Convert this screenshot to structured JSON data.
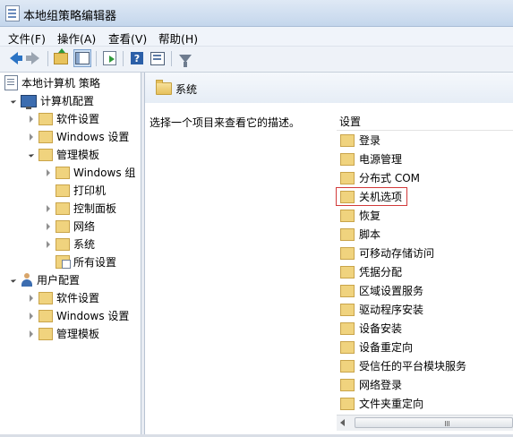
{
  "window": {
    "title": "本地组策略编辑器"
  },
  "menu": [
    "文件(F)",
    "操作(A)",
    "查看(V)",
    "帮助(H)"
  ],
  "toolbar": [
    {
      "name": "back-icon",
      "enabled": true
    },
    {
      "name": "forward-icon",
      "enabled": false
    },
    {
      "name": "up-folder-icon",
      "enabled": true
    },
    {
      "name": "show-hide-tree-icon",
      "enabled": true,
      "pressed": true
    },
    {
      "name": "export-list-icon",
      "enabled": true
    },
    {
      "name": "help-icon",
      "enabled": true
    },
    {
      "name": "properties-icon",
      "enabled": true
    },
    {
      "name": "filter-icon",
      "enabled": true
    }
  ],
  "tree": {
    "root": "本地计算机 策略",
    "computer_config": "计算机配置",
    "cc_software": "软件设置",
    "cc_windows": "Windows 设置",
    "cc_admin": "管理模板",
    "cc_admin_windows_components": "Windows 组",
    "cc_admin_printers": "打印机",
    "cc_admin_control_panel": "控制面板",
    "cc_admin_network": "网络",
    "cc_admin_system": "系统",
    "cc_admin_all_settings": "所有设置",
    "user_config": "用户配置",
    "uc_software": "软件设置",
    "uc_windows": "Windows 设置",
    "uc_admin": "管理模板"
  },
  "right": {
    "header_title": "系统",
    "description": "选择一个项目来查看它的描述。",
    "settings_column": "设置",
    "items": [
      "登录",
      "电源管理",
      "分布式 COM",
      "关机选项",
      "恢复",
      "脚本",
      "可移动存储访问",
      "凭据分配",
      "区域设置服务",
      "驱动程序安装",
      "设备安装",
      "设备重定向",
      "受信任的平台模块服务",
      "网络登录",
      "文件夹重定向"
    ],
    "highlighted_item": "关机选项"
  },
  "colors": {
    "highlight_outline": "#d23a3a",
    "folder": "#f0d37e"
  }
}
